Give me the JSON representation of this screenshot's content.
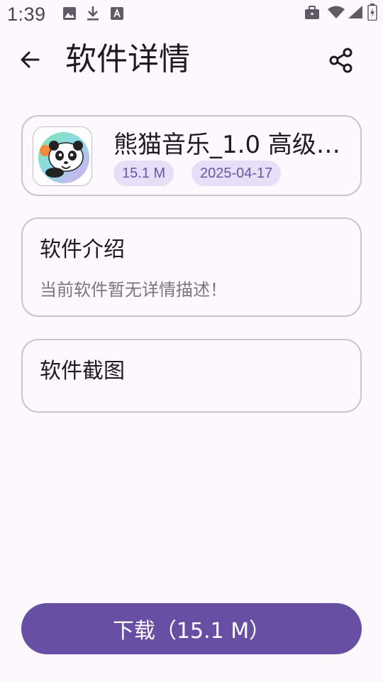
{
  "status_bar": {
    "time": "1:39",
    "left_icons": [
      "image-icon",
      "download-icon",
      "font-icon"
    ],
    "right_icons": [
      "briefcase-icon",
      "wifi-icon",
      "signal-icon",
      "battery-icon"
    ]
  },
  "app_bar": {
    "title": "软件详情",
    "back_icon": "arrow-left-icon",
    "share_icon": "share-icon"
  },
  "app_info": {
    "name": "熊猫音乐_1.0 高级…",
    "size": "15.1 M",
    "date": "2025-04-17"
  },
  "intro": {
    "heading": "软件介绍",
    "text": "当前软件暂无详情描述！"
  },
  "screenshots": {
    "heading": "软件截图"
  },
  "download": {
    "label": "下载（15.1 M）"
  },
  "colors": {
    "background": "#FDF7FE",
    "primary": "#6750A4",
    "chip_bg": "#E8DEF8",
    "chip_text": "#6A55A6",
    "outline": "#CAC4D0"
  }
}
